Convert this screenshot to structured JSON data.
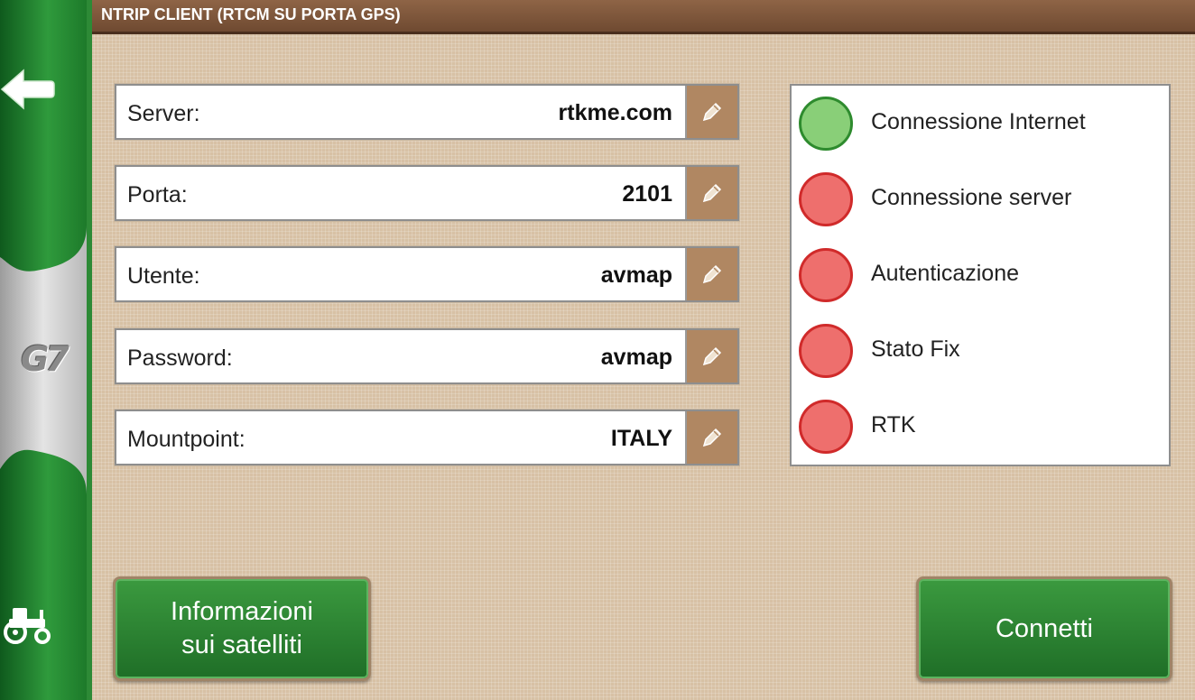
{
  "header": {
    "title": "NTRIP CLIENT (RTCM SU PORTA GPS)"
  },
  "sidebar": {
    "back_icon": "back-arrow-icon",
    "logo_text": "G7",
    "tractor_icon": "tractor-icon"
  },
  "fields": [
    {
      "label": "Server:",
      "value": "rtkme.com"
    },
    {
      "label": "Porta:",
      "value": "2101"
    },
    {
      "label": "Utente:",
      "value": "avmap"
    },
    {
      "label": "Password:",
      "value": "avmap"
    },
    {
      "label": "Mountpoint:",
      "value": "ITALY"
    }
  ],
  "edit_icon": "pencil-icon",
  "status": [
    {
      "label": "Connessione Internet",
      "state": "ok"
    },
    {
      "label": "Connessione server",
      "state": "error"
    },
    {
      "label": "Autenticazione",
      "state": "error"
    },
    {
      "label": "Stato Fix",
      "state": "error"
    },
    {
      "label": "RTK",
      "state": "error"
    }
  ],
  "buttons": {
    "satellites_line1": "Informazioni",
    "satellites_line2": "sui satelliti",
    "connect": "Connetti"
  },
  "colors": {
    "accent_green": "#2d8a36",
    "title_brown": "#7a5339",
    "status_ok": "#89cf78",
    "status_error": "#ee6f6d"
  }
}
